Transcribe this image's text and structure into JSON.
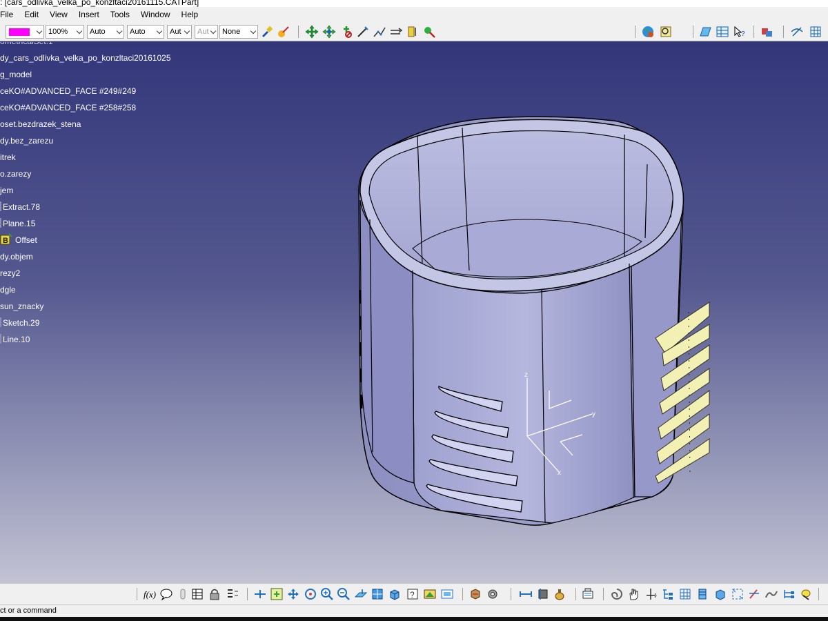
{
  "window": {
    "title": ": [cars_odlivka_velka_po_konzltaci20161115.CATPart]"
  },
  "menu": {
    "items": [
      "File",
      "Edit",
      "View",
      "Insert",
      "Tools",
      "Window",
      "Help"
    ]
  },
  "toolbar": {
    "color_swatch": "#ff00ff",
    "zoom_value": "100%",
    "linetype_value": "Auto",
    "thickness_value": "Auto",
    "layer_value": "Aut",
    "pattern_value": "Aut",
    "layer_filter_value": "None"
  },
  "tree": {
    "items": [
      "dy_cars_odlivka_velka_po_konzltaci20161025",
      "g_model",
      "ceKO#ADVANCED_FACE #249#249",
      "ceKO#ADVANCED_FACE #258#258",
      "oset.bezdrazek_stena",
      "dy.bez_zarezu",
      "itrek",
      "o.zarezy",
      "jem",
      "Extract.78",
      "Plane.15",
      "Offset",
      "dy.objem",
      "rezy2",
      "dgle",
      "sun_znacky",
      "Sketch.29",
      "Line.10"
    ]
  },
  "model": {
    "axis_labels": {
      "z": "z",
      "y": "y",
      "x": "x"
    },
    "colors": {
      "body": "#a6a8d6",
      "edges": "#000000",
      "fins": "#f2f0b2"
    }
  },
  "status": {
    "text": "ct or a command"
  }
}
